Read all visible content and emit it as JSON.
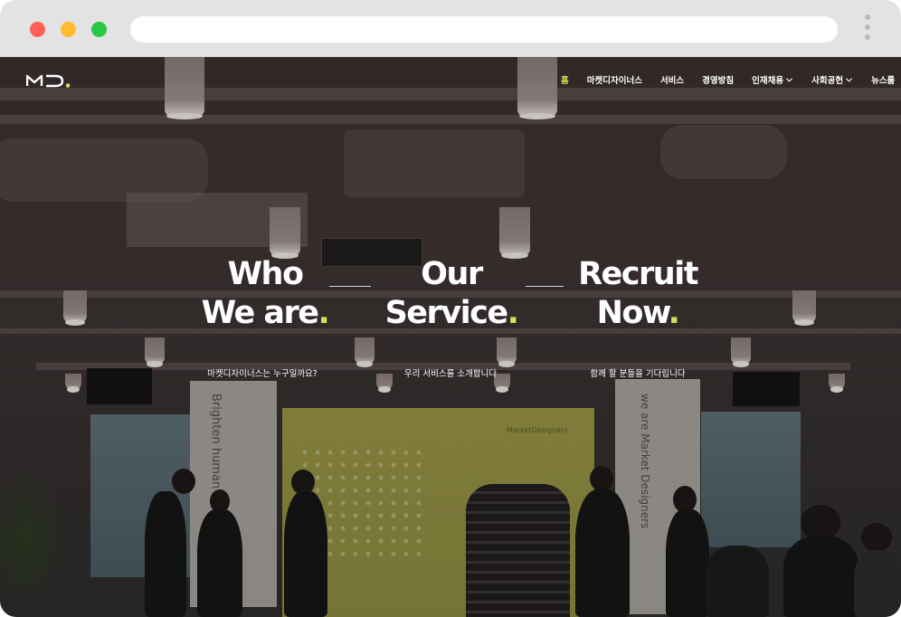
{
  "browser": {
    "url": "",
    "controls": [
      "close",
      "minimize",
      "maximize"
    ],
    "menu_icon": "kebab-menu-icon"
  },
  "site": {
    "logo_text": "MD.",
    "accent_color": "#d4e157",
    "nav": [
      {
        "label": "홈",
        "active": true,
        "dropdown": false
      },
      {
        "label": "마켓디자이너스",
        "active": false,
        "dropdown": false
      },
      {
        "label": "서비스",
        "active": false,
        "dropdown": false
      },
      {
        "label": "경영방침",
        "active": false,
        "dropdown": false
      },
      {
        "label": "인재채용",
        "active": false,
        "dropdown": true
      },
      {
        "label": "사회공헌",
        "active": false,
        "dropdown": true
      },
      {
        "label": "뉴스룸",
        "active": false,
        "dropdown": false
      }
    ]
  },
  "hero": {
    "columns": [
      {
        "line1": "Who",
        "line2": "We are",
        "period": ".",
        "subtitle": "마켓디자이너스는 누구일까요?"
      },
      {
        "line1": "Our",
        "line2": "Service",
        "period": ".",
        "subtitle": "우리 서비스를 소개합니다"
      },
      {
        "line1": "Recruit",
        "line2": "Now",
        "period": ".",
        "subtitle": "함께 할 분들을 기다립니다"
      }
    ]
  },
  "background_photo": {
    "screen_text": "MarketDesigners",
    "banner_left_text": "Brighten human",
    "banner_right_text": "we are Market Designers"
  }
}
